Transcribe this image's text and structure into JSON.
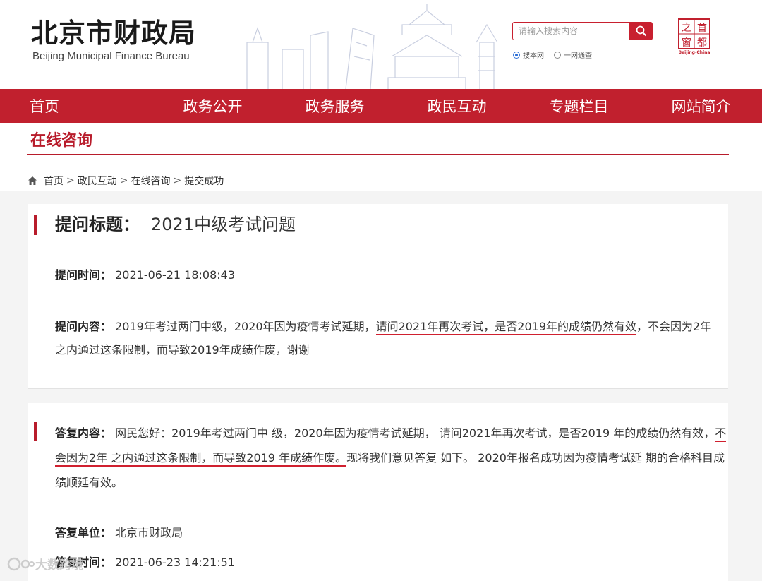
{
  "header": {
    "logo_cn": "北京市财政局",
    "logo_en": "Beijing Municipal Finance Bureau",
    "search": {
      "placeholder": "请输入搜索内容",
      "options": [
        "搜本网",
        "一网通查"
      ],
      "selected": "搜本网"
    },
    "seal": {
      "chars": [
        "之",
        "首",
        "都",
        "窗"
      ],
      "caption": "Beijing-China"
    }
  },
  "nav": {
    "items": [
      "首页",
      "政务公开",
      "政务服务",
      "政民互动",
      "专题栏目",
      "网站简介"
    ]
  },
  "section": {
    "title": "在线咨询",
    "breadcrumb": [
      "首页",
      "政民互动",
      "在线咨询",
      "提交成功"
    ],
    "breadcrumb_sep": ">"
  },
  "question": {
    "title_label": "提问标题：",
    "title_value": "2021中级考试问题",
    "time_label": "提问时间：",
    "time_value": "2021-06-21 18:08:43",
    "content_label": "提问内容：",
    "content_pre": "2019年考过两门中级，2020年因为疫情考试延期，",
    "content_highlight": "请问2021年再次考试，是否2019年的成绩仍然有效",
    "content_post": "，不会因为2年之内通过这条限制，而导致2019年成绩作废，谢谢"
  },
  "answer": {
    "content_label": "答复内容：",
    "content_pre": "网民您好：2019年考过两门中 级，2020年因为疫情考试延期， 请问2021年再次考试，是否2019 年的成绩仍然有效，",
    "content_highlight": "不会因为2年 之内通过这条限制，而导致2019 年成绩作废。",
    "content_post": "现将我们意见答复 如下。 2020年报名成功因为疫情考试延 期的合格科目成绩顺延有效。",
    "unit_label": "答复单位：",
    "unit_value": "北京市财政局",
    "time_label": "答复时间：",
    "time_value": "2021-06-23 14:21:51"
  },
  "watermark": "大数跨境",
  "colors": {
    "brand_red": "#c1202e",
    "underline_red": "#d0202f",
    "page_bg": "#f4f4f4"
  }
}
